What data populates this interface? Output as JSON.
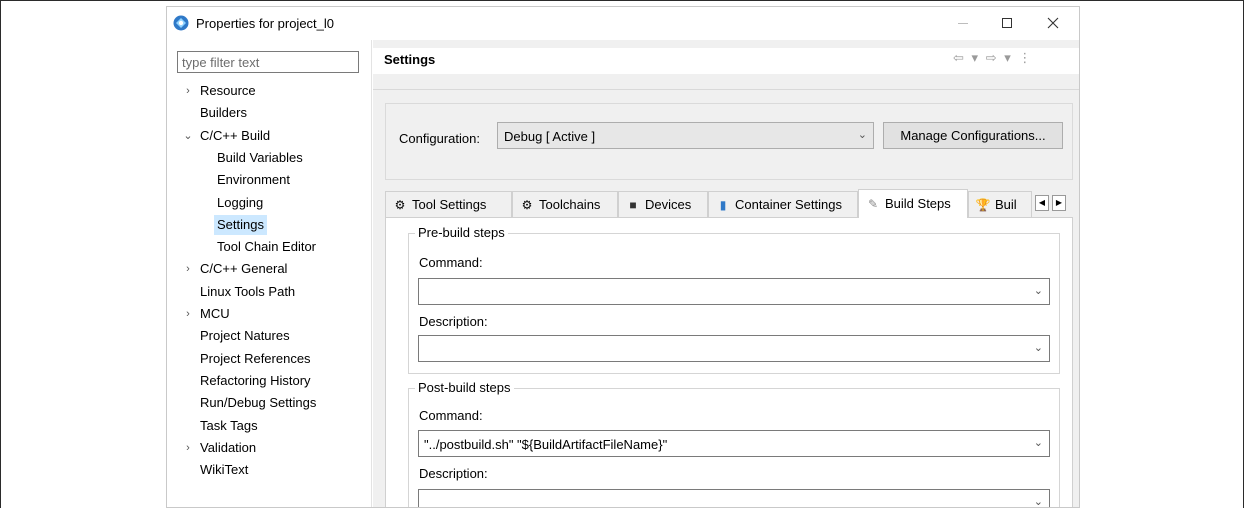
{
  "window": {
    "title": "Properties for project_l0",
    "controls": {
      "minimize": "—",
      "maximize": "☐",
      "close": "✕"
    }
  },
  "sidebar": {
    "filter_placeholder": "type filter text",
    "items": [
      {
        "label": "Resource",
        "expander": "›",
        "level": 0
      },
      {
        "label": "Builders",
        "expander": "",
        "level": 0
      },
      {
        "label": "C/C++ Build",
        "expander": "⌄",
        "level": 0
      },
      {
        "label": "Build Variables",
        "expander": "",
        "level": 1
      },
      {
        "label": "Environment",
        "expander": "",
        "level": 1
      },
      {
        "label": "Logging",
        "expander": "",
        "level": 1
      },
      {
        "label": "Settings",
        "expander": "",
        "level": 1,
        "selected": true
      },
      {
        "label": "Tool Chain Editor",
        "expander": "",
        "level": 1
      },
      {
        "label": "C/C++ General",
        "expander": "›",
        "level": 0
      },
      {
        "label": "Linux Tools Path",
        "expander": "",
        "level": 0
      },
      {
        "label": "MCU",
        "expander": "›",
        "level": 0
      },
      {
        "label": "Project Natures",
        "expander": "",
        "level": 0
      },
      {
        "label": "Project References",
        "expander": "",
        "level": 0
      },
      {
        "label": "Refactoring History",
        "expander": "",
        "level": 0
      },
      {
        "label": "Run/Debug Settings",
        "expander": "",
        "level": 0
      },
      {
        "label": "Task Tags",
        "expander": "",
        "level": 0
      },
      {
        "label": "Validation",
        "expander": "›",
        "level": 0
      },
      {
        "label": "WikiText",
        "expander": "",
        "level": 0
      }
    ]
  },
  "header": {
    "title": "Settings",
    "nav": {
      "back": "⇦",
      "forward": "⇨",
      "dropdown": "▾",
      "menu": "⋮"
    }
  },
  "configuration": {
    "label": "Configuration:",
    "value": "Debug  [ Active ]",
    "manage_label": "Manage Configurations..."
  },
  "tabs": [
    {
      "label": "Tool Settings",
      "icon": "gear-icon",
      "glyph": "⚙"
    },
    {
      "label": "Toolchains",
      "icon": "gear-icon",
      "glyph": "⚙"
    },
    {
      "label": "Devices",
      "icon": "chip-icon",
      "glyph": "■"
    },
    {
      "label": "Container Settings",
      "icon": "container-icon",
      "glyph": "▮"
    },
    {
      "label": "Build Steps",
      "icon": "build-steps-icon",
      "glyph": "✎",
      "active": true
    },
    {
      "label": "Buil",
      "icon": "trophy-icon",
      "glyph": "🏆"
    }
  ],
  "build_steps": {
    "pre": {
      "title": "Pre-build steps",
      "command_label": "Command:",
      "command_value": "",
      "description_label": "Description:",
      "description_value": ""
    },
    "post": {
      "title": "Post-build steps",
      "command_label": "Command:",
      "command_value": "\"../postbuild.sh\" \"${BuildArtifactFileName}\"",
      "description_label": "Description:",
      "description_value": ""
    }
  },
  "colors": {
    "selection": "#cce8ff",
    "panel_bg": "#f0f0f0",
    "border": "#adadad"
  }
}
